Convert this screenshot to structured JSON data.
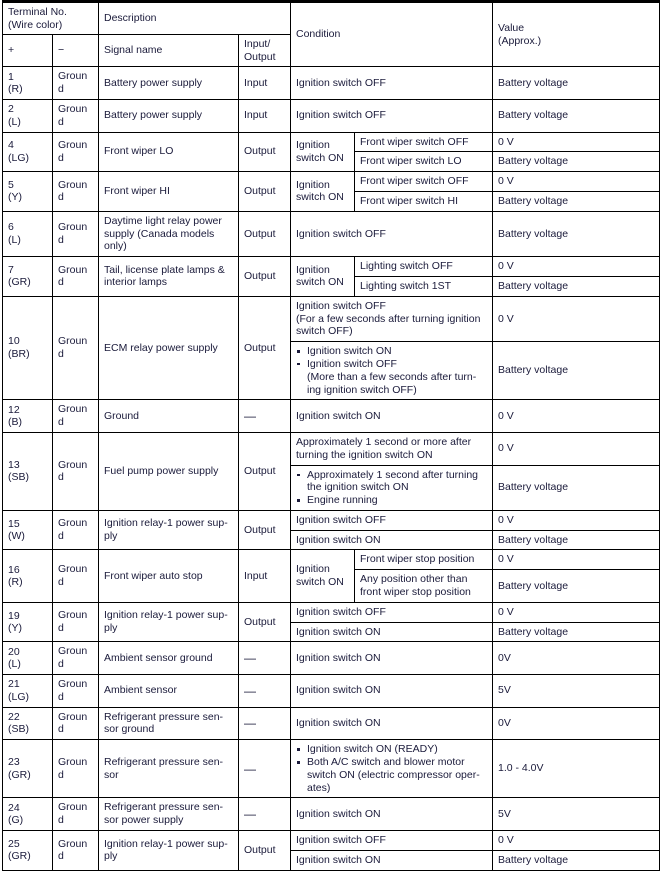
{
  "table": {
    "headers": {
      "terminal_no": "Terminal No.",
      "wire_color": "(Wire color)",
      "plus": "+",
      "minus": "−",
      "description": "Description",
      "signal_name": "Signal name",
      "input_line1": "Input/",
      "input_line2": "Output",
      "condition": "Condition",
      "value_line1": "Value",
      "value_line2": "(Approx.)"
    },
    "rows": [
      {
        "terminal": "1",
        "wire_color": "(R)",
        "ground": "Ground",
        "signal_name": "Battery power supply",
        "io": "Input",
        "entries": [
          {
            "condition": "Ignition switch OFF",
            "value": "Battery voltage"
          }
        ]
      },
      {
        "terminal": "2",
        "wire_color": "(L)",
        "ground": "Ground",
        "signal_name": "Battery power supply",
        "io": "Input",
        "entries": [
          {
            "condition": "Ignition switch OFF",
            "value": "Battery voltage"
          }
        ]
      },
      {
        "terminal": "4",
        "wire_color": "(LG)",
        "ground": "Ground",
        "signal_name": "Front wiper LO",
        "io": "Output",
        "group_label_line1": "Ignition",
        "group_label_line2": "switch ON",
        "entries": [
          {
            "condition": "Front wiper switch OFF",
            "value": "0 V"
          },
          {
            "condition": "Front wiper switch LO",
            "value": "Battery voltage"
          }
        ]
      },
      {
        "terminal": "5",
        "wire_color": "(Y)",
        "ground": "Ground",
        "signal_name": "Front wiper HI",
        "io": "Output",
        "group_label_line1": "Ignition",
        "group_label_line2": "switch ON",
        "entries": [
          {
            "condition": "Front wiper switch OFF",
            "value": "0 V"
          },
          {
            "condition": "Front wiper switch HI",
            "value": "Battery voltage"
          }
        ]
      },
      {
        "terminal": "6",
        "wire_color": "(L)",
        "ground": "Ground",
        "signal_name": "Daytime light relay power supply (Canada models only)",
        "io": "Output",
        "entries": [
          {
            "condition": "Ignition switch OFF",
            "value": "Battery voltage"
          }
        ]
      },
      {
        "terminal": "7",
        "wire_color": "(GR)",
        "ground": "Ground",
        "signal_name": "Tail, license plate lamps & interior lamps",
        "io": "Output",
        "group_label_line1": "Ignition",
        "group_label_line2": "switch ON",
        "entries": [
          {
            "condition": "Lighting switch OFF",
            "value": "0 V"
          },
          {
            "condition": "Lighting switch 1ST",
            "value": "Battery voltage"
          }
        ]
      },
      {
        "terminal": "10",
        "wire_color": "(BR)",
        "ground": "Ground",
        "signal_name": "ECM relay power supply",
        "io": "Output",
        "entries": [
          {
            "condition_lines": [
              "Ignition switch OFF",
              "(For a few seconds after turning ignition",
              "switch OFF)"
            ],
            "value": "0 V"
          },
          {
            "bullets": [
              [
                "Ignition switch ON"
              ],
              [
                "Ignition switch OFF",
                "(More than a few seconds after turn-",
                "ing ignition switch OFF)"
              ]
            ],
            "value": "Battery voltage"
          }
        ]
      },
      {
        "terminal": "12",
        "wire_color": "(B)",
        "ground": "Ground",
        "signal_name": "Ground",
        "io": "—",
        "entries": [
          {
            "condition": "Ignition switch ON",
            "value": "0 V"
          }
        ]
      },
      {
        "terminal": "13",
        "wire_color": "(SB)",
        "ground": "Ground",
        "signal_name": "Fuel pump power supply",
        "io": "Output",
        "entries": [
          {
            "condition_lines": [
              "Approximately 1 second or more after",
              "turning the ignition switch ON"
            ],
            "value": "0 V"
          },
          {
            "bullets": [
              [
                "Approximately 1 second after turning",
                "the ignition switch ON"
              ],
              [
                "Engine running"
              ]
            ],
            "value": "Battery voltage"
          }
        ]
      },
      {
        "terminal": "15",
        "wire_color": "(W)",
        "ground": "Ground",
        "signal_name": "Ignition relay-1 power sup-ply",
        "io": "Output",
        "entries": [
          {
            "condition": "Ignition switch OFF",
            "value": "0 V"
          },
          {
            "condition": "Ignition switch ON",
            "value": "Battery voltage"
          }
        ]
      },
      {
        "terminal": "16",
        "wire_color": "(R)",
        "ground": "Ground",
        "signal_name": "Front wiper auto stop",
        "io": "Input",
        "group_label_line1": "Ignition",
        "group_label_line2": "switch ON",
        "entries": [
          {
            "condition": "Front wiper stop position",
            "value": "0 V"
          },
          {
            "condition_lines": [
              "Any position other than",
              "front wiper stop position"
            ],
            "value": "Battery voltage"
          }
        ]
      },
      {
        "terminal": "19",
        "wire_color": "(Y)",
        "ground": "Ground",
        "signal_name": "Ignition relay-1 power sup-ply",
        "io": "Output",
        "entries": [
          {
            "condition": "Ignition switch OFF",
            "value": "0 V"
          },
          {
            "condition": "Ignition switch ON",
            "value": "Battery voltage"
          }
        ]
      },
      {
        "terminal": "20",
        "wire_color": "(L)",
        "ground": "Ground",
        "signal_name": "Ambient sensor ground",
        "io": "—",
        "entries": [
          {
            "condition": "Ignition switch ON",
            "value": "0V"
          }
        ]
      },
      {
        "terminal": "21",
        "wire_color": "(LG)",
        "ground": "Ground",
        "signal_name": "Ambient sensor",
        "io": "—",
        "entries": [
          {
            "condition": "Ignition switch ON",
            "value": "5V"
          }
        ]
      },
      {
        "terminal": "22",
        "wire_color": "(SB)",
        "ground": "Ground",
        "signal_name": "Refrigerant pressure sen-sor ground",
        "io": "—",
        "entries": [
          {
            "condition": "Ignition switch ON",
            "value": "0V"
          }
        ]
      },
      {
        "terminal": "23",
        "wire_color": "(GR)",
        "ground": "Ground",
        "signal_name": "Refrigerant pressure sen-sor",
        "io": "—",
        "entries": [
          {
            "bullets": [
              [
                "Ignition switch ON (READY)"
              ],
              [
                "Both A/C switch and blower motor",
                "switch ON (electric compressor oper-",
                "ates)"
              ]
            ],
            "value": "1.0 - 4.0V"
          }
        ]
      },
      {
        "terminal": "24",
        "wire_color": "(G)",
        "ground": "Ground",
        "signal_name": "Refrigerant pressure sen-sor power supply",
        "io": "—",
        "entries": [
          {
            "condition": "Ignition switch ON",
            "value": "5V"
          }
        ]
      },
      {
        "terminal": "25",
        "wire_color": "(GR)",
        "ground": "Ground",
        "signal_name": "Ignition relay-1 power sup-ply",
        "io": "Output",
        "entries": [
          {
            "condition": "Ignition switch OFF",
            "value": "0 V"
          },
          {
            "condition": "Ignition switch ON",
            "value": "Battery voltage"
          }
        ]
      }
    ]
  }
}
